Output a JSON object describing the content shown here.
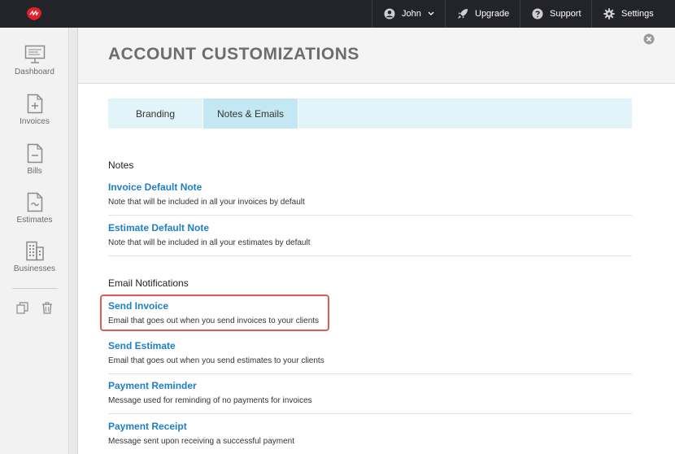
{
  "topbar": {
    "user_name": "John",
    "upgrade_label": "Upgrade",
    "support_label": "Support",
    "settings_label": "Settings"
  },
  "sidebar": {
    "items": [
      {
        "label": "Dashboard",
        "icon": "monitor-icon"
      },
      {
        "label": "Invoices",
        "icon": "invoice-plus-icon"
      },
      {
        "label": "Bills",
        "icon": "bill-minus-icon"
      },
      {
        "label": "Estimates",
        "icon": "estimate-tilde-icon"
      },
      {
        "label": "Businesses",
        "icon": "building-icon"
      }
    ],
    "tools": [
      "copy-icon",
      "trash-icon"
    ]
  },
  "page": {
    "title": "ACCOUNT CUSTOMIZATIONS"
  },
  "tabs": [
    {
      "label": "Branding",
      "active": false
    },
    {
      "label": "Notes & Emails",
      "active": true
    }
  ],
  "notes": {
    "title": "Notes",
    "items": [
      {
        "label": "Invoice Default Note",
        "desc": "Note that will be included in all your invoices by default"
      },
      {
        "label": "Estimate Default Note",
        "desc": "Note that will be included in all your estimates by default"
      }
    ]
  },
  "emails": {
    "title": "Email Notifications",
    "items": [
      {
        "label": "Send Invoice",
        "desc": "Email that goes out when you send invoices to your clients"
      },
      {
        "label": "Send Estimate",
        "desc": "Email that goes out when you send estimates to your clients"
      },
      {
        "label": "Payment Reminder",
        "desc": "Message used for reminding of no payments for invoices"
      },
      {
        "label": "Payment Receipt",
        "desc": "Message sent upon receiving a successful payment"
      }
    ]
  },
  "colors": {
    "topbar": "#23232a",
    "link": "#1f7fc4",
    "tab_active": "#c3e7f3",
    "tab_bg": "#e1f4f9",
    "highlight": "#e05a5a",
    "logo": "#e0202a"
  }
}
